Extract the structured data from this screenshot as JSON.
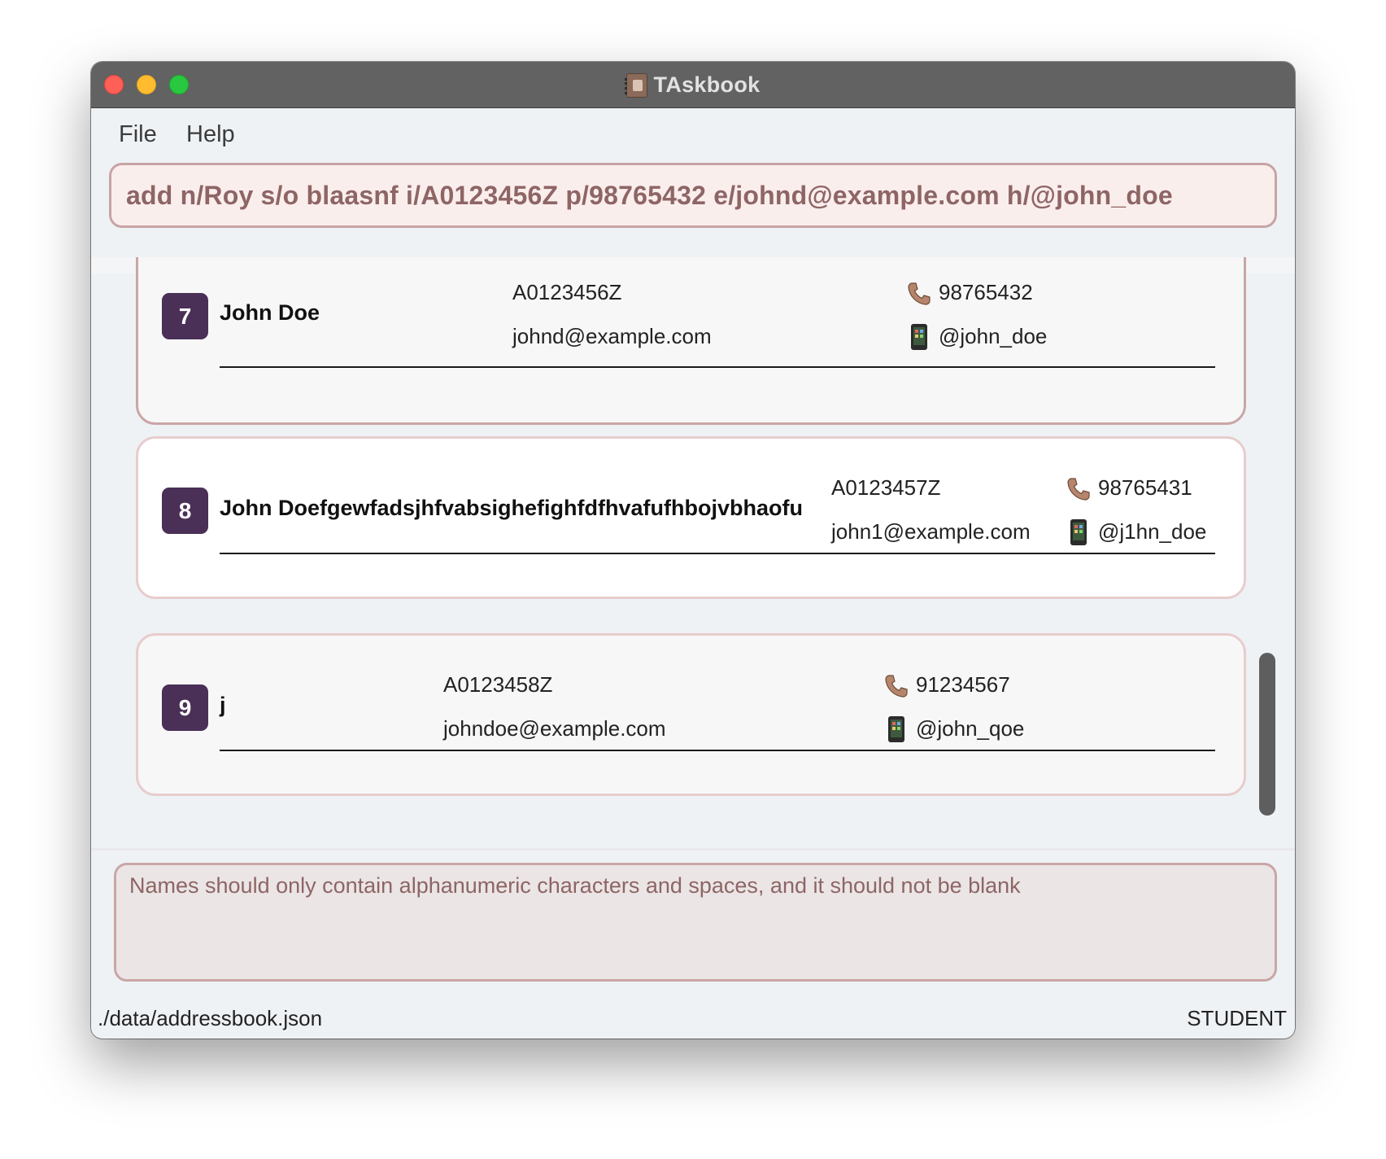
{
  "window": {
    "title": "TAskbook",
    "app_icon": "address-book-icon"
  },
  "menu": {
    "file": "File",
    "help": "Help"
  },
  "command": {
    "value": "add n/Roy s/o blaasnf i/A0123456Z p/98765432 e/johnd@example.com h/@john_doe"
  },
  "persons": [
    {
      "index": "7",
      "name": "John Doe",
      "student_id": "A0123456Z",
      "email": "johnd@example.com",
      "phone": "98765432",
      "handle": "@john_doe"
    },
    {
      "index": "8",
      "name": "John Doefgewfadsjhfvabsighefighfdfhvafufhbojvbhaofu",
      "student_id": "A0123457Z",
      "email": "john1@example.com",
      "phone": "98765431",
      "handle": "@j1hn_doe"
    },
    {
      "index": "9",
      "name": "j",
      "student_id": "A0123458Z",
      "email": "johndoe@example.com",
      "phone": "91234567",
      "handle": "@john_qoe"
    }
  ],
  "result": {
    "message": "Names should only contain alphanumeric characters and spaces, and it should not be blank"
  },
  "status": {
    "file_path": "./data/addressbook.json",
    "mode": "STUDENT"
  },
  "colors": {
    "badge": "#4a2f57",
    "command_text": "#8e6565",
    "card_border": "#e7cdcd"
  }
}
